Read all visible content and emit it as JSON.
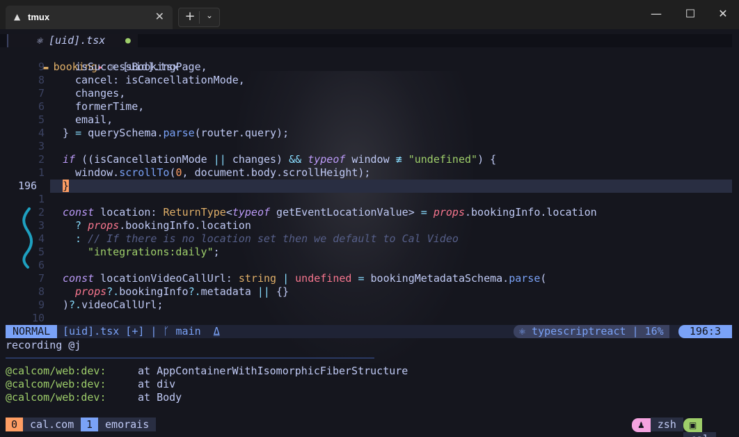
{
  "window": {
    "tab_title": "tmux",
    "tab_icon": "tux-icon",
    "close_glyph": "✕",
    "new_tab_glyph": "+",
    "dropdown_glyph": "⌵",
    "min_glyph": "—",
    "max_glyph": "☐",
    "close_win_glyph": "✕"
  },
  "editor": {
    "buffer_tab": "⚛ [uid].tsx",
    "buffer_modified": "●",
    "breadcrumb_dir": "booking",
    "breadcrumb_file": "⚛ [uid].tsx",
    "lines": [
      {
        "n": "9",
        "t": "isSuccessBookingPage,"
      },
      {
        "n": "8",
        "t": "cancel: isCancellationMode,"
      },
      {
        "n": "7",
        "t": "changes,"
      },
      {
        "n": "6",
        "t": "formerTime,"
      },
      {
        "n": "5",
        "t": "email,"
      },
      {
        "n": "4",
        "t": "} = querySchema.parse(router.query);"
      },
      {
        "n": "3",
        "t": ""
      },
      {
        "n": "2",
        "t": "if ((isCancellationMode || changes) && typeof window ≢ \"undefined\") {"
      },
      {
        "n": "1",
        "t": "window.scrollTo(0, document.body.scrollHeight);"
      },
      {
        "n": "196",
        "t": "}"
      },
      {
        "n": "1",
        "t": ""
      },
      {
        "n": "2",
        "t": "const location: ReturnType<typeof getEventLocationValue> = props.bookingInfo.location"
      },
      {
        "n": "3",
        "t": "? props.bookingInfo.location"
      },
      {
        "n": "4",
        "t": ": // If there is no location set then we default to Cal Video"
      },
      {
        "n": "5",
        "t": "\"integrations:daily\";"
      },
      {
        "n": "6",
        "t": ""
      },
      {
        "n": "7",
        "t": "const locationVideoCallUrl: string | undefined = bookingMetadataSchema.parse("
      },
      {
        "n": "8",
        "t": "props?.bookingInfo?.metadata || {}"
      },
      {
        "n": "9",
        "t": ")?.videoCallUrl;"
      },
      {
        "n": "10",
        "t": ""
      }
    ]
  },
  "statusline": {
    "mode": "NORMAL",
    "file": "[uid].tsx [+] | ᚴ main  ⍙",
    "filetype": "⚛ typescriptreact | 16%",
    "position": "196:3"
  },
  "cmdline": "recording @j",
  "output": [
    {
      "prefix": "@calcom/web:dev:",
      "text": "at AppContainerWithIsomorphicFiberStructure"
    },
    {
      "prefix": "@calcom/web:dev:",
      "text": "at div"
    },
    {
      "prefix": "@calcom/web:dev:",
      "text": "at Body"
    }
  ],
  "tmux": {
    "windows": [
      {
        "index": "0",
        "name": "cal.com",
        "color": "#ff9e64"
      },
      {
        "index": "1",
        "name": "emorais",
        "color": "#7aa2f7"
      }
    ],
    "right": [
      {
        "icon": "🐧",
        "name": "zsh",
        "color": "#f5a3e0"
      },
      {
        "icon": "⌨",
        "name": "cal",
        "color": "#9ece6a"
      }
    ]
  },
  "colors": {
    "accent": "#7aa2f7",
    "bg": "#15161e",
    "keyword": "#bb9af7",
    "string": "#9ece6a"
  }
}
